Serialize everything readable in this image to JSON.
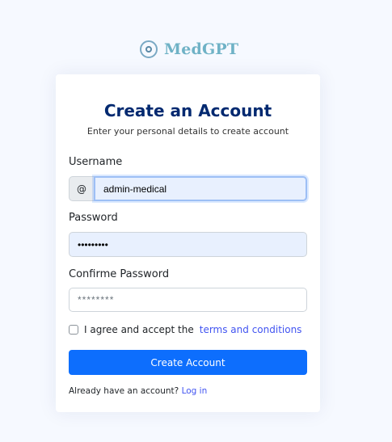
{
  "brand": {
    "name": "MedGPT",
    "icon": "medgpt-logo-icon",
    "color": "#6fb2c6"
  },
  "form": {
    "title": "Create an Account",
    "subtitle": "Enter your personal details to create account",
    "username": {
      "label": "Username",
      "prefix": "@",
      "value": "admin-medical"
    },
    "password": {
      "label": "Password",
      "value": "•••••••••"
    },
    "confirm": {
      "label": "Confirme Password",
      "placeholder": "********",
      "value": ""
    },
    "terms": {
      "text": "I agree and accept the",
      "link": "terms and conditions",
      "checked": false
    },
    "submit_label": "Create Account",
    "login_prompt": "Already have an account?",
    "login_link": "Log in"
  },
  "colors": {
    "primary": "#0d6efd",
    "title": "#012970",
    "link": "#4154f1",
    "background": "#f6f9ff"
  }
}
